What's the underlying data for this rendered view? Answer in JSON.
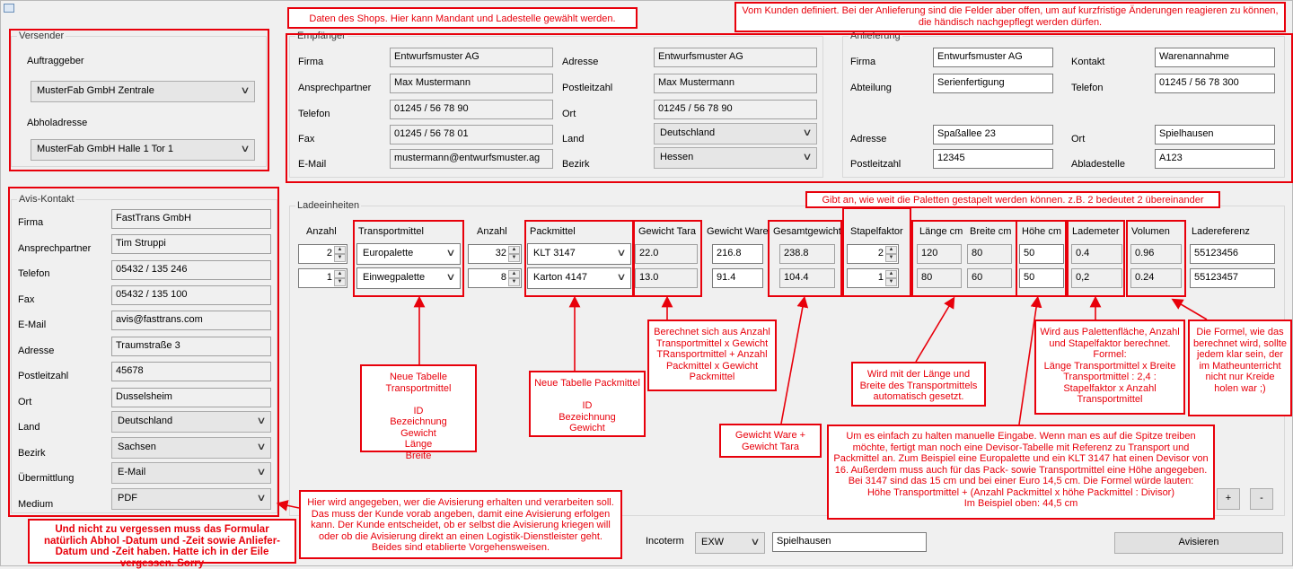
{
  "versender": {
    "title": "Versender",
    "auftraggeber_label": "Auftraggeber",
    "auftraggeber_value": "MusterFab GmbH  Zentrale",
    "abholadresse_label": "Abholadresse",
    "abholadresse_value": "MusterFab GmbH  Halle 1 Tor 1"
  },
  "empfaenger": {
    "title": "Empfänger",
    "labels": {
      "firma": "Firma",
      "ansprechpartner": "Ansprechpartner",
      "telefon": "Telefon",
      "fax": "Fax",
      "email": "E-Mail",
      "adresse": "Adresse",
      "plz": "Postleitzahl",
      "ort": "Ort",
      "land": "Land",
      "bezirk": "Bezirk"
    },
    "values": {
      "firma": "Entwurfsmuster AG",
      "ansprechpartner": "Max Mustermann",
      "telefon": "01245 / 56 78 90",
      "fax": "01245 / 56 78 01",
      "email": "mustermann@entwurfsmuster.ag",
      "adresse": "Entwurfsmuster AG",
      "plz": "Max Mustermann",
      "ort": "01245 / 56 78 90",
      "land": "Deutschland",
      "bezirk": "Hessen"
    }
  },
  "anlieferung": {
    "title": "Anlieferung",
    "labels": {
      "firma": "Firma",
      "abteilung": "Abteilung",
      "kontakt": "Kontakt",
      "telefon": "Telefon",
      "adresse": "Adresse",
      "plz": "Postleitzahl",
      "ort": "Ort",
      "abladestelle": "Abladestelle"
    },
    "values": {
      "firma": "Entwurfsmuster AG",
      "abteilung": "Serienfertigung",
      "kontakt": "Warenannahme",
      "telefon": "01245 / 56 78 300",
      "adresse": "Spaßallee 23",
      "plz": "12345",
      "ort": "Spielhausen",
      "abladestelle": "A123"
    }
  },
  "avis": {
    "title": "Avis-Kontakt",
    "labels": {
      "firma": "Firma",
      "ansprechpartner": "Ansprechpartner",
      "telefon": "Telefon",
      "fax": "Fax",
      "email": "E-Mail",
      "adresse": "Adresse",
      "plz": "Postleitzahl",
      "ort": "Ort",
      "land": "Land",
      "bezirk": "Bezirk",
      "uebermittlung": "Übermittlung",
      "medium": "Medium"
    },
    "values": {
      "firma": "FastTrans GmbH",
      "ansprechpartner": "Tim Struppi",
      "telefon": "05432 / 135 246",
      "fax": "05432 / 135 100",
      "email": "avis@fasttrans.com",
      "adresse": "Traumstraße 3",
      "plz": "45678",
      "ort": "Dusselsheim",
      "land": "Deutschland",
      "bezirk": "Sachsen",
      "uebermittlung": "E-Mail",
      "medium": "PDF"
    }
  },
  "ladeeinheiten": {
    "title": "Ladeeinheiten",
    "headers": {
      "anzahl1": "Anzahl",
      "transportmittel": "Transportmittel",
      "anzahl2": "Anzahl",
      "packmittel": "Packmittel",
      "gewicht_tara": "Gewicht Tara",
      "gewicht_ware": "Gewicht Ware",
      "gesamtgewicht": "Gesamtgewicht",
      "stapelfaktor": "Stapelfaktor",
      "laenge": "Länge cm",
      "breite": "Breite cm",
      "hoehe": "Höhe cm",
      "lademeter": "Lademeter",
      "volumen": "Volumen",
      "ladereferenz": "Ladereferenz"
    },
    "rows": [
      {
        "anzahl1": "2",
        "transportmittel": "Europalette",
        "anzahl2": "32",
        "packmittel": "KLT 3147",
        "gewicht_tara": "22.0",
        "gewicht_ware": "216.8",
        "gesamtgewicht": "238.8",
        "stapelfaktor": "2",
        "laenge": "120",
        "breite": "80",
        "hoehe": "50",
        "lademeter": "0.4",
        "volumen": "0.96",
        "ladereferenz": "55123456"
      },
      {
        "anzahl1": "1",
        "transportmittel": "Einwegpalette",
        "anzahl2": "8",
        "packmittel": "Karton 4147",
        "gewicht_tara": "13.0",
        "gewicht_ware": "91.4",
        "gesamtgewicht": "104.4",
        "stapelfaktor": "1",
        "laenge": "80",
        "breite": "60",
        "hoehe": "50",
        "lademeter": "0,2",
        "volumen": "0.24",
        "ladereferenz": "55123457"
      }
    ],
    "plus_label": "+",
    "minus_label": "-"
  },
  "footer": {
    "incoterm_label": "Incoterm",
    "incoterm_value": "EXW",
    "incoterm_ort": "Spielhausen",
    "avisieren_label": "Avisieren"
  },
  "notes": {
    "shop": "Daten des Shops. Hier kann Mandant und Ladestelle gewählt werden.",
    "kunde": "Vom Kunden definiert. Bei der Anlieferung sind die Felder aber offen, um auf kurzfristige Änderungen reagieren zu können, die händisch nachgepflegt werden dürfen.",
    "stapel": "Gibt an, wie weit die Paletten gestapelt werden können. z.B. 2 bedeutet 2 übereinander",
    "transportmittel": "Neue Tabelle Transportmittel\n\nID\nBezeichnung\nGewicht\nLänge\nBreite",
    "packmittel": "Neue Tabelle Packmittel\n\nID\nBezeichnung\nGewicht",
    "tara": "Berechnet sich aus Anzahl Transportmittel x Gewicht TRansportmittel + Anzahl Packmittel x Gewicht Packmittel",
    "gesamt": "Gewicht Ware +\nGewicht Tara",
    "laenge": "Wird mit der Länge und Breite des Transportmittels automatisch gesetzt.",
    "lademeter": "Wird aus Palettenfläche, Anzahl und Stapelfaktor berechnet. Formel:\nLänge Transportmittel x Breite Transportmittel : 2,4 :\nStapelfaktor x Anzahl Transportmittel",
    "volumen": "Die Formel, wie das berechnet wird, sollte jedem klar sein, der im Matheunterricht nicht nur Kreide holen war ;)",
    "hoehe": "Um es einfach zu halten manuelle Eingabe. Wenn man es auf die Spitze treiben möchte, fertigt man noch eine Devisor-Tabelle mit Referenz zu Transport und Packmittel an. Zum Beispiel eine Europalette und ein KLT 3147 hat einen Devisor von 16. Außerdem muss auch für das Pack- sowie Transportmittel eine Höhe angegeben. Bei 3147 sind das 15 cm und bei einer Euro 14,5 cm. Die Formel würde lauten:\nHöhe Transportmittel + (Anzahl Packmittel x höhe Packmittel : Divisor)\nIm Beispiel oben: 44,5 cm",
    "avis": "Hier wird angegeben, wer die Avisierung erhalten und verarbeiten soll. Das muss der Kunde vorab angeben, damit eine Avisierung erfolgen kann. Der Kunde entscheidet, ob er selbst die Avisierung kriegen will oder ob die Avisierung direkt an einen Logistik-Dienstleister geht. Beides sind etablierte Vorgehensweisen.",
    "datum": "Und nicht zu vergessen muss das Formular natürlich Abhol -Datum und -Zeit sowie Anliefer-Datum und -Zeit haben. Hatte ich in der Eile vergessen. Sorry"
  },
  "colors": {
    "annotation": "#e8000b",
    "background": "#f0f0f0"
  }
}
